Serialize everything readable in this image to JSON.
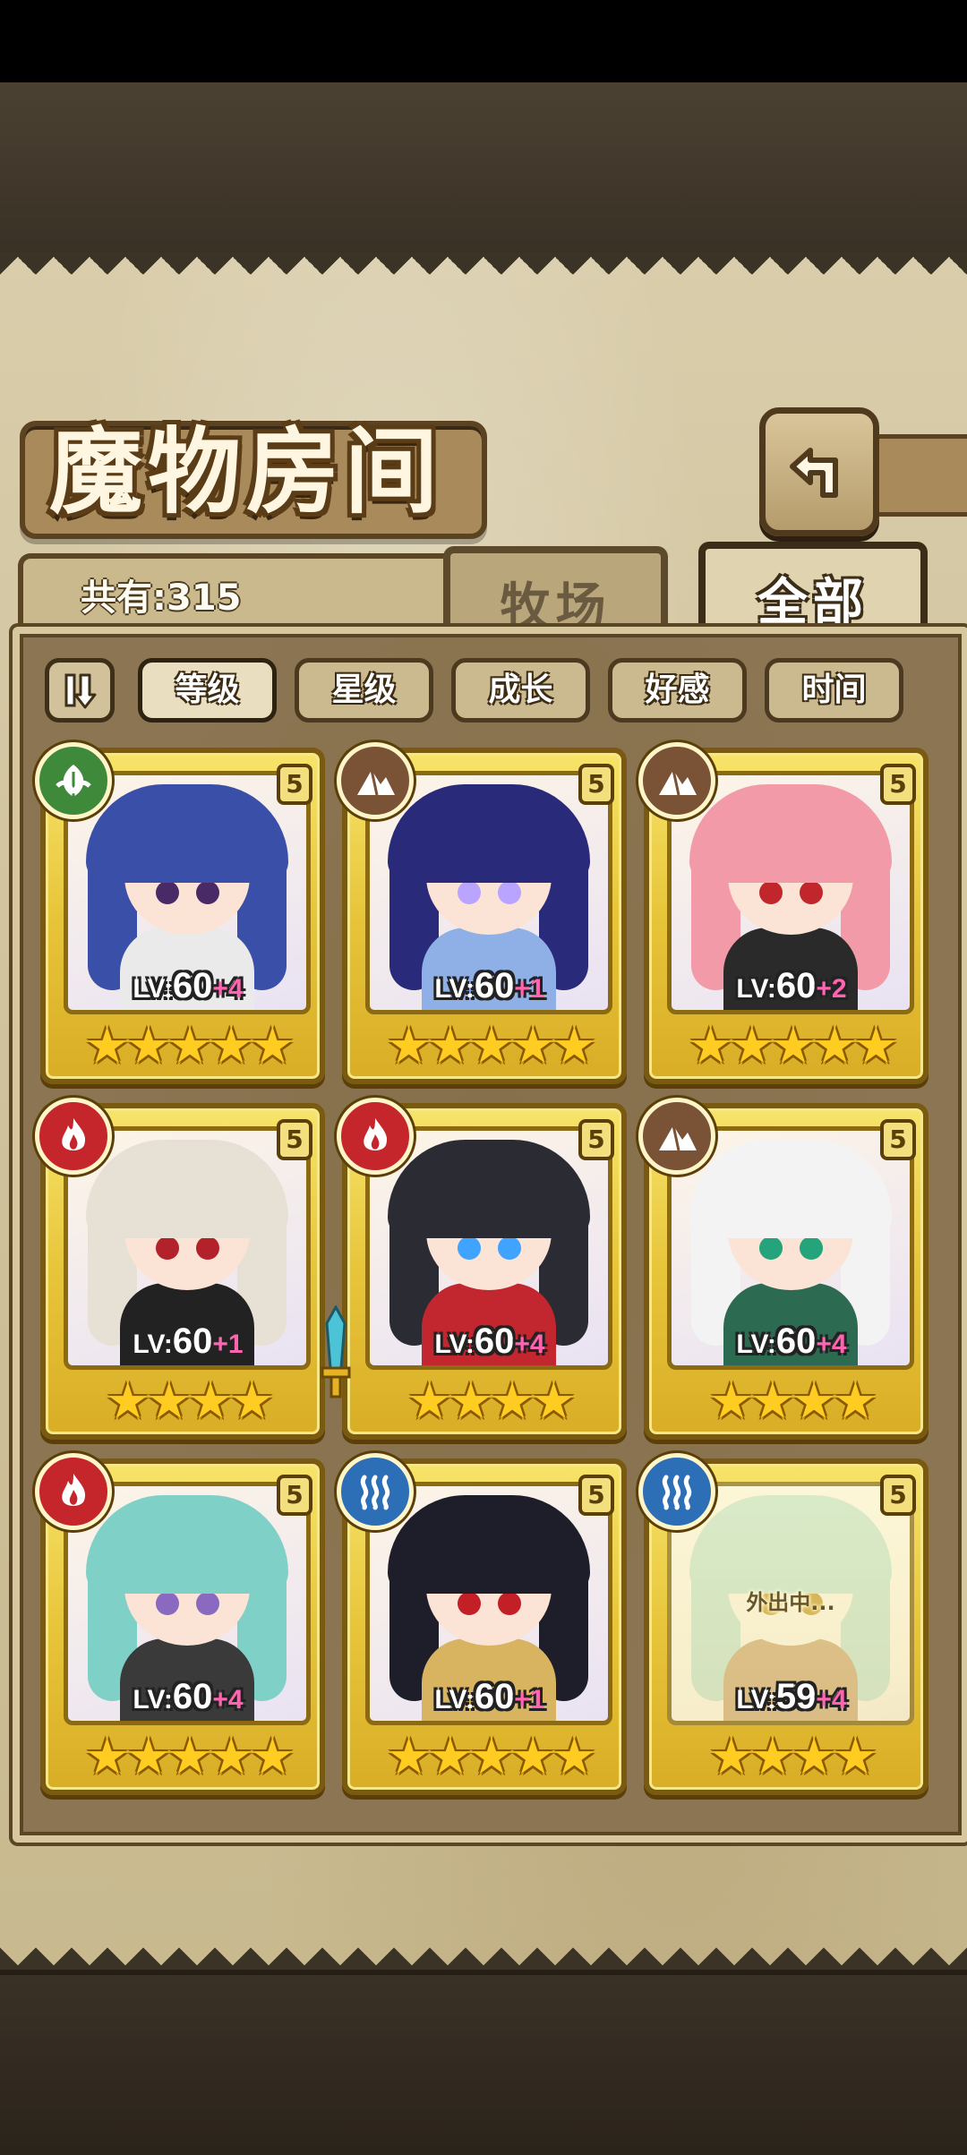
{
  "header": {
    "title": "魔物房间",
    "count_label": "共有:315",
    "tabs": [
      {
        "label": "牧场",
        "active": false
      },
      {
        "label": "全部",
        "active": true
      }
    ]
  },
  "sort": {
    "toggle_icon": "sort-order-icon",
    "options": [
      {
        "label": "等级",
        "active": true
      },
      {
        "label": "星级",
        "active": false
      },
      {
        "label": "成长",
        "active": false
      },
      {
        "label": "好感",
        "active": false
      },
      {
        "label": "时间",
        "active": false
      }
    ]
  },
  "colors": {
    "nature": "#3f8a3a",
    "earth": "#7a5236",
    "fire": "#c4262b",
    "water": "#2c6fb6",
    "plus": "#ff64b0",
    "star": "#ffcc22"
  },
  "monsters": [
    {
      "element": "nature",
      "element_icon": "leaf-icon",
      "rank": "5",
      "lv_prefix": "LV:",
      "level": "60",
      "plus": "+4",
      "stars": "★★★★★",
      "hair": "#3a4fa8",
      "eyes": "#4a2a66",
      "outfit": "#eaeaea",
      "away": false
    },
    {
      "element": "earth",
      "element_icon": "mountain-icon",
      "rank": "5",
      "lv_prefix": "LV:",
      "level": "60",
      "plus": "+1",
      "stars": "★★★★★",
      "hair": "#2a2a7a",
      "eyes": "#b9a4ff",
      "outfit": "#8fb0e6",
      "away": false
    },
    {
      "element": "earth",
      "element_icon": "mountain-icon",
      "rank": "5",
      "lv_prefix": "LV:",
      "level": "60",
      "plus": "+2",
      "stars": "★★★★★",
      "hair": "#f29aa8",
      "eyes": "#c0262b",
      "outfit": "#2a2a2a",
      "away": false
    },
    {
      "element": "fire",
      "element_icon": "flame-icon",
      "rank": "5",
      "lv_prefix": "LV:",
      "level": "60",
      "plus": "+1",
      "stars": "★★★★",
      "hair": "#e6e1d4",
      "eyes": "#b3222a",
      "outfit": "#222222",
      "away": false
    },
    {
      "element": "fire",
      "element_icon": "flame-icon",
      "rank": "5",
      "lv_prefix": "LV:",
      "level": "60",
      "plus": "+4",
      "stars": "★★★★",
      "hair": "#2b2b33",
      "eyes": "#3fa3ff",
      "outfit": "#c2262e",
      "away": false,
      "equip": true
    },
    {
      "element": "earth",
      "element_icon": "mountain-icon",
      "rank": "5",
      "lv_prefix": "LV:",
      "level": "60",
      "plus": "+4",
      "stars": "★★★★",
      "hair": "#f3f3f3",
      "eyes": "#25a37a",
      "outfit": "#2c6a52",
      "away": false
    },
    {
      "element": "fire",
      "element_icon": "flame-icon",
      "rank": "5",
      "lv_prefix": "LV:",
      "level": "60",
      "plus": "+4",
      "stars": "★★★★★",
      "hair": "#7fd1c8",
      "eyes": "#8a6ac0",
      "outfit": "#3a3a3a",
      "away": false
    },
    {
      "element": "water",
      "element_icon": "waves-icon",
      "rank": "5",
      "lv_prefix": "LV:",
      "level": "60",
      "plus": "+1",
      "stars": "★★★★★",
      "hair": "#1e1e2a",
      "eyes": "#c21f26",
      "outfit": "#d8b460",
      "away": false
    },
    {
      "element": "water",
      "element_icon": "waves-icon",
      "rank": "5",
      "lv_prefix": "LV:",
      "level": "59",
      "plus": "+4",
      "stars": "★★★★",
      "hair": "#a8d4cf",
      "eyes": "#c69a2a",
      "outfit": "#c9a47a",
      "away": true,
      "away_label": "外出中..."
    }
  ]
}
